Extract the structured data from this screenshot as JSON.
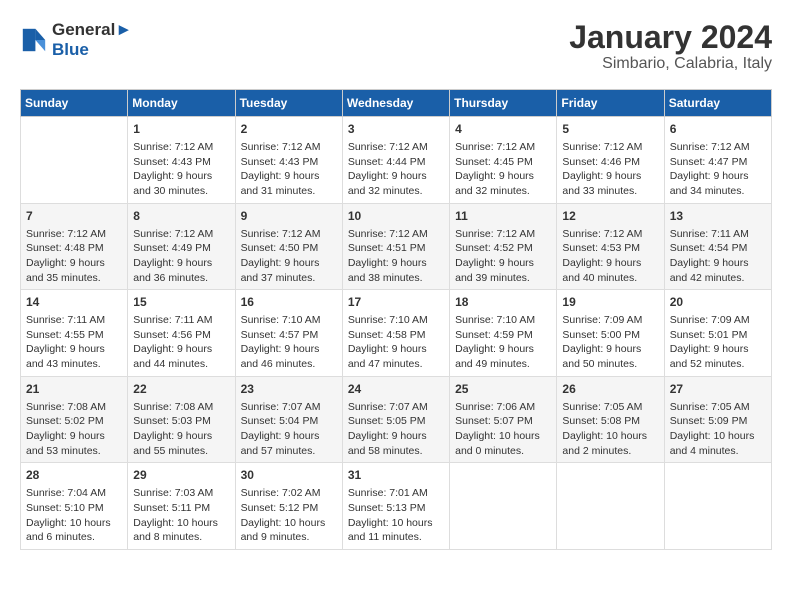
{
  "header": {
    "logo_line1": "General",
    "logo_line2": "Blue",
    "title": "January 2024",
    "subtitle": "Simbario, Calabria, Italy"
  },
  "columns": [
    "Sunday",
    "Monday",
    "Tuesday",
    "Wednesday",
    "Thursday",
    "Friday",
    "Saturday"
  ],
  "weeks": [
    {
      "cells": [
        {
          "day": "",
          "lines": []
        },
        {
          "day": "1",
          "lines": [
            "Sunrise: 7:12 AM",
            "Sunset: 4:43 PM",
            "Daylight: 9 hours",
            "and 30 minutes."
          ]
        },
        {
          "day": "2",
          "lines": [
            "Sunrise: 7:12 AM",
            "Sunset: 4:43 PM",
            "Daylight: 9 hours",
            "and 31 minutes."
          ]
        },
        {
          "day": "3",
          "lines": [
            "Sunrise: 7:12 AM",
            "Sunset: 4:44 PM",
            "Daylight: 9 hours",
            "and 32 minutes."
          ]
        },
        {
          "day": "4",
          "lines": [
            "Sunrise: 7:12 AM",
            "Sunset: 4:45 PM",
            "Daylight: 9 hours",
            "and 32 minutes."
          ]
        },
        {
          "day": "5",
          "lines": [
            "Sunrise: 7:12 AM",
            "Sunset: 4:46 PM",
            "Daylight: 9 hours",
            "and 33 minutes."
          ]
        },
        {
          "day": "6",
          "lines": [
            "Sunrise: 7:12 AM",
            "Sunset: 4:47 PM",
            "Daylight: 9 hours",
            "and 34 minutes."
          ]
        }
      ]
    },
    {
      "cells": [
        {
          "day": "7",
          "lines": [
            "Sunrise: 7:12 AM",
            "Sunset: 4:48 PM",
            "Daylight: 9 hours",
            "and 35 minutes."
          ]
        },
        {
          "day": "8",
          "lines": [
            "Sunrise: 7:12 AM",
            "Sunset: 4:49 PM",
            "Daylight: 9 hours",
            "and 36 minutes."
          ]
        },
        {
          "day": "9",
          "lines": [
            "Sunrise: 7:12 AM",
            "Sunset: 4:50 PM",
            "Daylight: 9 hours",
            "and 37 minutes."
          ]
        },
        {
          "day": "10",
          "lines": [
            "Sunrise: 7:12 AM",
            "Sunset: 4:51 PM",
            "Daylight: 9 hours",
            "and 38 minutes."
          ]
        },
        {
          "day": "11",
          "lines": [
            "Sunrise: 7:12 AM",
            "Sunset: 4:52 PM",
            "Daylight: 9 hours",
            "and 39 minutes."
          ]
        },
        {
          "day": "12",
          "lines": [
            "Sunrise: 7:12 AM",
            "Sunset: 4:53 PM",
            "Daylight: 9 hours",
            "and 40 minutes."
          ]
        },
        {
          "day": "13",
          "lines": [
            "Sunrise: 7:11 AM",
            "Sunset: 4:54 PM",
            "Daylight: 9 hours",
            "and 42 minutes."
          ]
        }
      ]
    },
    {
      "cells": [
        {
          "day": "14",
          "lines": [
            "Sunrise: 7:11 AM",
            "Sunset: 4:55 PM",
            "Daylight: 9 hours",
            "and 43 minutes."
          ]
        },
        {
          "day": "15",
          "lines": [
            "Sunrise: 7:11 AM",
            "Sunset: 4:56 PM",
            "Daylight: 9 hours",
            "and 44 minutes."
          ]
        },
        {
          "day": "16",
          "lines": [
            "Sunrise: 7:10 AM",
            "Sunset: 4:57 PM",
            "Daylight: 9 hours",
            "and 46 minutes."
          ]
        },
        {
          "day": "17",
          "lines": [
            "Sunrise: 7:10 AM",
            "Sunset: 4:58 PM",
            "Daylight: 9 hours",
            "and 47 minutes."
          ]
        },
        {
          "day": "18",
          "lines": [
            "Sunrise: 7:10 AM",
            "Sunset: 4:59 PM",
            "Daylight: 9 hours",
            "and 49 minutes."
          ]
        },
        {
          "day": "19",
          "lines": [
            "Sunrise: 7:09 AM",
            "Sunset: 5:00 PM",
            "Daylight: 9 hours",
            "and 50 minutes."
          ]
        },
        {
          "day": "20",
          "lines": [
            "Sunrise: 7:09 AM",
            "Sunset: 5:01 PM",
            "Daylight: 9 hours",
            "and 52 minutes."
          ]
        }
      ]
    },
    {
      "cells": [
        {
          "day": "21",
          "lines": [
            "Sunrise: 7:08 AM",
            "Sunset: 5:02 PM",
            "Daylight: 9 hours",
            "and 53 minutes."
          ]
        },
        {
          "day": "22",
          "lines": [
            "Sunrise: 7:08 AM",
            "Sunset: 5:03 PM",
            "Daylight: 9 hours",
            "and 55 minutes."
          ]
        },
        {
          "day": "23",
          "lines": [
            "Sunrise: 7:07 AM",
            "Sunset: 5:04 PM",
            "Daylight: 9 hours",
            "and 57 minutes."
          ]
        },
        {
          "day": "24",
          "lines": [
            "Sunrise: 7:07 AM",
            "Sunset: 5:05 PM",
            "Daylight: 9 hours",
            "and 58 minutes."
          ]
        },
        {
          "day": "25",
          "lines": [
            "Sunrise: 7:06 AM",
            "Sunset: 5:07 PM",
            "Daylight: 10 hours",
            "and 0 minutes."
          ]
        },
        {
          "day": "26",
          "lines": [
            "Sunrise: 7:05 AM",
            "Sunset: 5:08 PM",
            "Daylight: 10 hours",
            "and 2 minutes."
          ]
        },
        {
          "day": "27",
          "lines": [
            "Sunrise: 7:05 AM",
            "Sunset: 5:09 PM",
            "Daylight: 10 hours",
            "and 4 minutes."
          ]
        }
      ]
    },
    {
      "cells": [
        {
          "day": "28",
          "lines": [
            "Sunrise: 7:04 AM",
            "Sunset: 5:10 PM",
            "Daylight: 10 hours",
            "and 6 minutes."
          ]
        },
        {
          "day": "29",
          "lines": [
            "Sunrise: 7:03 AM",
            "Sunset: 5:11 PM",
            "Daylight: 10 hours",
            "and 8 minutes."
          ]
        },
        {
          "day": "30",
          "lines": [
            "Sunrise: 7:02 AM",
            "Sunset: 5:12 PM",
            "Daylight: 10 hours",
            "and 9 minutes."
          ]
        },
        {
          "day": "31",
          "lines": [
            "Sunrise: 7:01 AM",
            "Sunset: 5:13 PM",
            "Daylight: 10 hours",
            "and 11 minutes."
          ]
        },
        {
          "day": "",
          "lines": []
        },
        {
          "day": "",
          "lines": []
        },
        {
          "day": "",
          "lines": []
        }
      ]
    }
  ]
}
